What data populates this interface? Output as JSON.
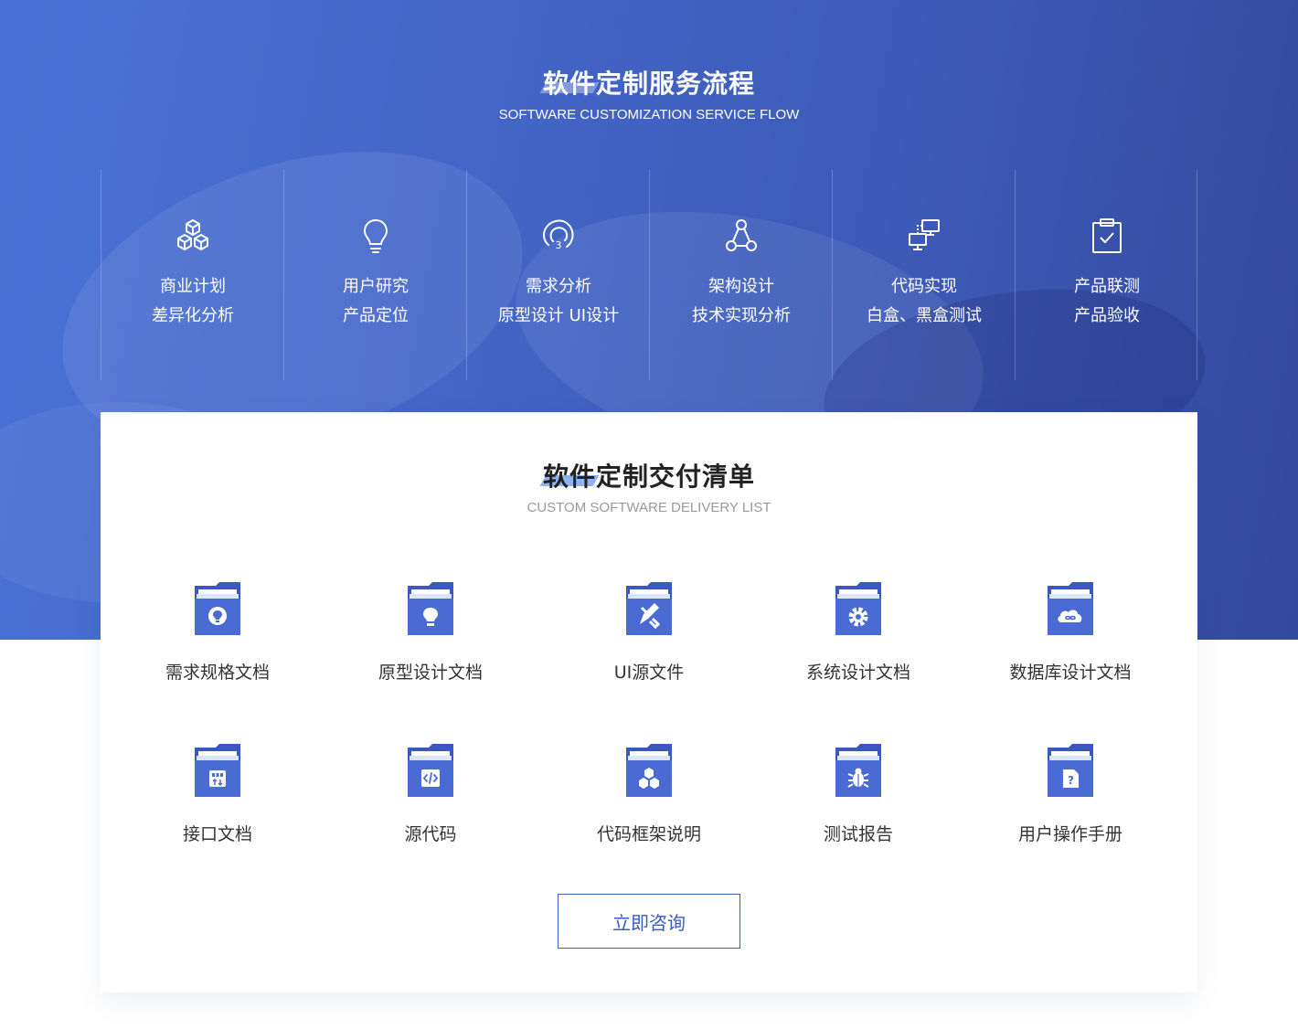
{
  "colors": {
    "accent": "#3a5ac4",
    "hero_start": "#4a72d6",
    "hero_end": "#33499e"
  },
  "service_flow": {
    "title": "软件定制服务流程",
    "subtitle": "SOFTWARE CUSTOMIZATION SERVICE FLOW",
    "steps": [
      {
        "icon": "cubes-icon",
        "line1": "商业计划",
        "line2": "差异化分析"
      },
      {
        "icon": "lightbulb-icon",
        "line1": "用户研究",
        "line2": "产品定位"
      },
      {
        "icon": "target-3-icon",
        "line1": "需求分析",
        "line2": "原型设计 UI设计"
      },
      {
        "icon": "nodes-icon",
        "line1": "架构设计",
        "line2": "技术实现分析"
      },
      {
        "icon": "monitors-icon",
        "line1": "代码实现",
        "line2": "白盒、黑盒测试"
      },
      {
        "icon": "clipboard-check-icon",
        "line1": "产品联测",
        "line2": "产品验收"
      }
    ]
  },
  "delivery_list": {
    "title": "软件定制交付清单",
    "subtitle": "CUSTOM SOFTWARE DELIVERY LIST",
    "items": [
      {
        "icon": "folder-bulb-icon",
        "label": "需求规格文档"
      },
      {
        "icon": "folder-lightbulb-icon",
        "label": "原型设计文档"
      },
      {
        "icon": "folder-pencil-icon",
        "label": "UI源文件"
      },
      {
        "icon": "folder-gear-icon",
        "label": "系统设计文档"
      },
      {
        "icon": "folder-cloud-icon",
        "label": "数据库设计文档"
      },
      {
        "icon": "folder-api-icon",
        "label": "接口文档"
      },
      {
        "icon": "folder-code-icon",
        "label": "源代码"
      },
      {
        "icon": "folder-cubes-icon",
        "label": "代码框架说明"
      },
      {
        "icon": "folder-bug-icon",
        "label": "测试报告"
      },
      {
        "icon": "folder-question-icon",
        "label": "用户操作手册"
      }
    ]
  },
  "consult_button": {
    "label": "立即咨询"
  }
}
